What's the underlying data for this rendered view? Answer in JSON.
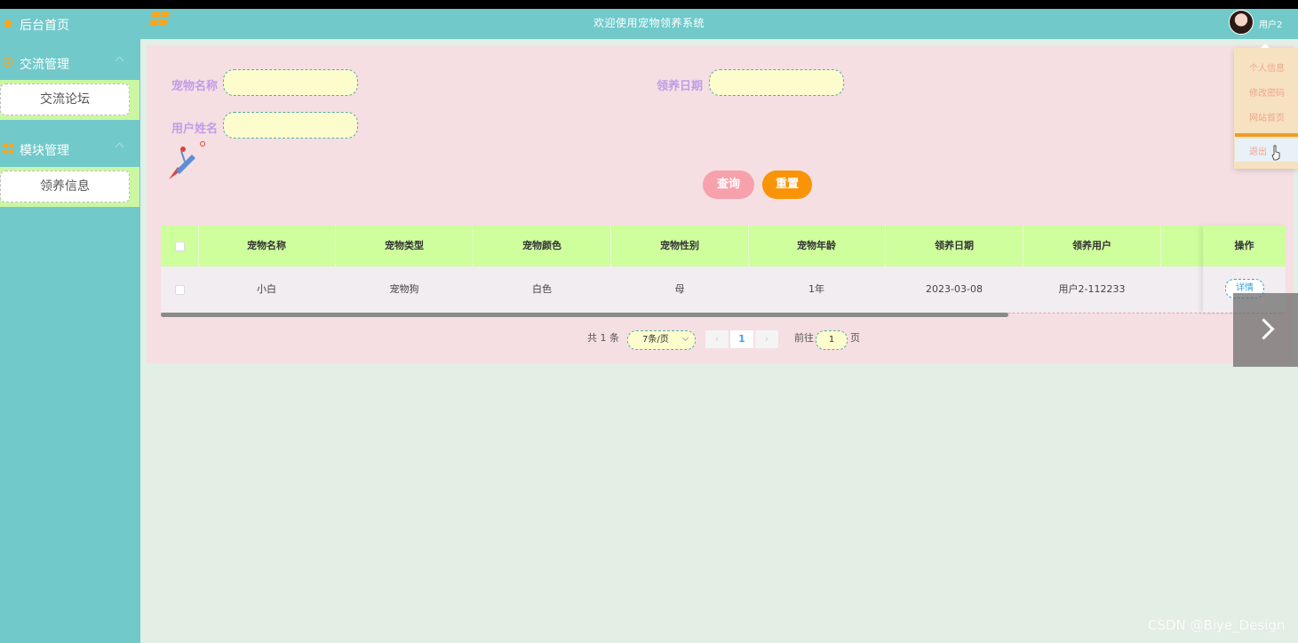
{
  "header": {
    "title": "欢迎使用宠物领养系统",
    "username": "用户2"
  },
  "sidebar": {
    "home": "后台首页",
    "groups": [
      {
        "label": "交流管理",
        "sub": "交流论坛"
      },
      {
        "label": "模块管理",
        "sub": "领养信息"
      }
    ]
  },
  "search": {
    "pet_name_label": "宠物名称",
    "adopt_date_label": "领养日期",
    "user_name_label": "用户姓名",
    "query_button": "查询",
    "reset_button": "重置"
  },
  "table": {
    "columns": [
      "宠物名称",
      "宠物类型",
      "宠物颜色",
      "宠物性别",
      "宠物年龄",
      "领养日期",
      "领养用户"
    ],
    "op_header": "操作",
    "rows": [
      {
        "cells": [
          "小白",
          "宠物狗",
          "白色",
          "母",
          "1年",
          "2023-03-08",
          "用户2-112233"
        ],
        "detail": "详情"
      }
    ]
  },
  "pagination": {
    "total": "共 1 条",
    "page_size": "7条/页",
    "current": "1",
    "goto_prefix": "前往",
    "goto_value": "1",
    "goto_suffix": "页"
  },
  "dropdown": {
    "items": [
      "个人信息",
      "修改密码",
      "网站首页",
      "退出"
    ]
  },
  "watermark": "CSDN @Biye_Design",
  "colors": {
    "teal": "#71c9ca",
    "lime": "#cffe9d",
    "pink": "#f5dfe2",
    "orange": "#f99408",
    "pinkbtn": "#f7a1ad"
  }
}
